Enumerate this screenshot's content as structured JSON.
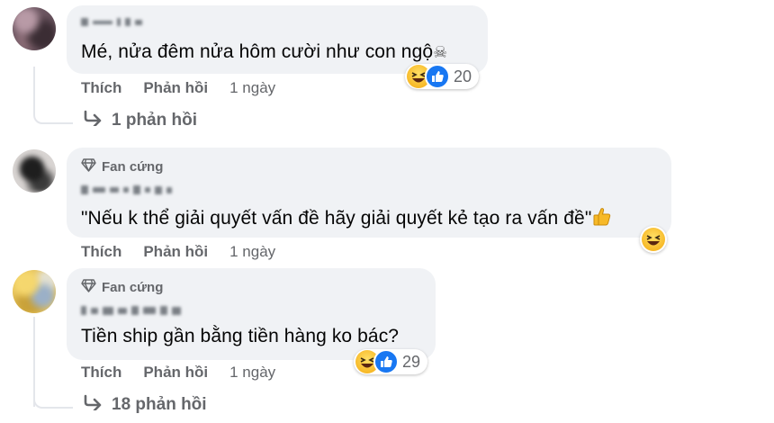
{
  "comments": [
    {
      "badge": "",
      "text": "Mé, nửa đêm nửa hôm cười như con ngộ",
      "reactions_count": "20",
      "actions": {
        "like": "Thích",
        "reply": "Phản hồi",
        "time": "1 ngày"
      },
      "replies_link": "1 phản hồi"
    },
    {
      "badge": "Fan cứng",
      "text": "\"Nếu k thể giải quyết vấn đề hãy giải quyết kẻ tạo ra vấn đề\"",
      "reactions_count": "",
      "actions": {
        "like": "Thích",
        "reply": "Phản hồi",
        "time": "1 ngày"
      },
      "replies_link": ""
    },
    {
      "badge": "Fan cứng",
      "text": "Tiền ship gần bằng tiền hàng ko bác?",
      "reactions_count": "29",
      "actions": {
        "like": "Thích",
        "reply": "Phản hồi",
        "time": "1 ngày"
      },
      "replies_link": "18 phản hồi"
    }
  ],
  "icons": {
    "skull": "☠",
    "diamond": "diamond-icon",
    "haha": "haha-reaction-icon",
    "like": "like-reaction-icon",
    "thumbs_up": "thumbs-up-emoji-icon",
    "reply_arrow": "reply-arrow-icon"
  },
  "colors": {
    "bubble": "#f0f2f5",
    "secondary_text": "#65676b",
    "like_blue": "#1877f2",
    "haha_yellow": "#f7b928"
  }
}
